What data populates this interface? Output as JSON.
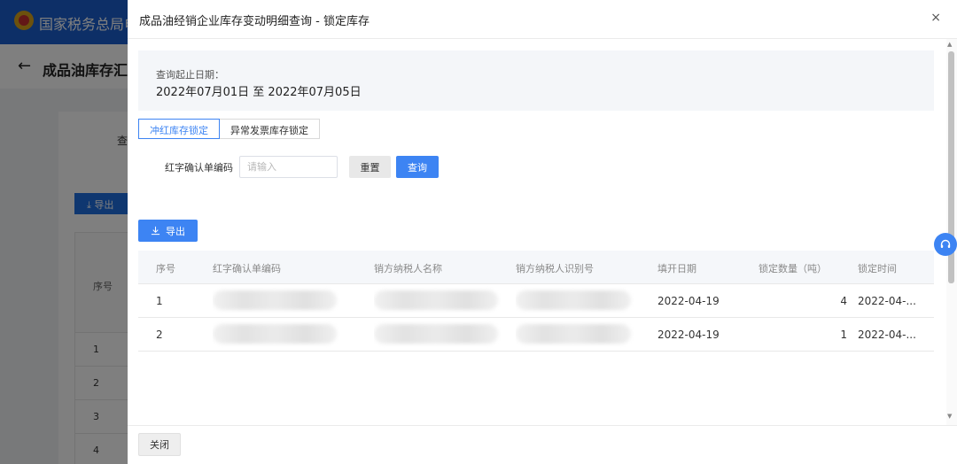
{
  "background": {
    "site_title": "国家税务总局电",
    "page_title": "成品油库存汇",
    "query_label": "查",
    "export_label": "导出",
    "table_header": "序号",
    "row_numbers": [
      "1",
      "2",
      "3",
      "4"
    ]
  },
  "drawer": {
    "title": "成品油经销企业库存变动明细查询 - 锁定库存",
    "close_symbol": "×",
    "date_label": "查询起止日期：",
    "date_range": "2022年07月01日 至 2022年07月05日",
    "tabs": [
      {
        "label": "冲红库存锁定",
        "active": true
      },
      {
        "label": "异常发票库存锁定",
        "active": false
      }
    ],
    "filter": {
      "label": "红字确认单编码",
      "placeholder": "请输入",
      "value": "",
      "reset_label": "重置",
      "search_label": "查询"
    },
    "export_label": "导出",
    "table": {
      "columns": [
        "序号",
        "红字确认单编码",
        "销方纳税人名称",
        "销方纳税人识别号",
        "填开日期",
        "锁定数量（吨）",
        "锁定时间"
      ],
      "rows": [
        {
          "index": "1",
          "code": "",
          "seller_name": "",
          "seller_id": "",
          "issue_date": "2022-04-19",
          "locked_qty": "4",
          "lock_time": "2022-04-..."
        },
        {
          "index": "2",
          "code": "",
          "seller_name": "",
          "seller_id": "",
          "issue_date": "2022-04-19",
          "locked_qty": "1",
          "lock_time": "2022-04-..."
        }
      ]
    },
    "footer": {
      "close_label": "关闭"
    }
  },
  "colors": {
    "primary": "#3d84f3",
    "site_header": "#1b5ecf",
    "overlay": "rgba(0,0,0,0.5)"
  },
  "icons": [
    "back-arrow-icon",
    "close-icon",
    "download-icon",
    "headset-icon",
    "scroll-up-icon",
    "scroll-down-icon"
  ]
}
